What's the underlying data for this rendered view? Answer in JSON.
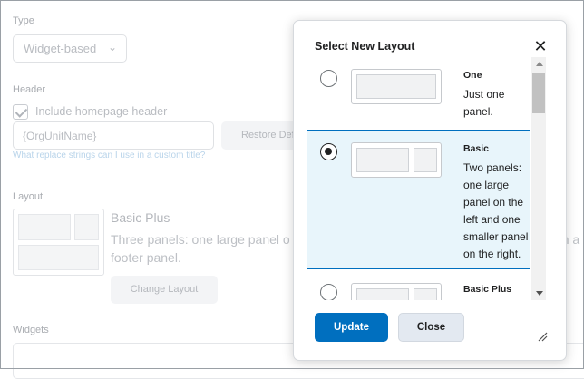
{
  "page": {
    "type_label": "Type",
    "type_select_value": "Widget-based",
    "header_label": "Header",
    "include_header_label": "Include homepage header",
    "title_input_value": "{OrgUnitName}",
    "restore_button_label": "Restore Default",
    "help_link": "What replace strings can I use in a custom title?",
    "layout_label": "Layout",
    "current_layout_name": "Basic Plus",
    "current_layout_desc_line1a": "Three panels: one large panel o",
    "current_layout_desc_line1b": "h a",
    "current_layout_desc_line2": "footer panel.",
    "change_layout_label": "Change Layout",
    "widgets_label": "Widgets"
  },
  "dialog": {
    "title": "Select New Layout",
    "close_icon": "close-icon",
    "options": [
      {
        "name": "One",
        "desc": "Just one panel.",
        "selected": false
      },
      {
        "name": "Basic",
        "desc": "Two panels: one large panel on the left and one smaller panel on the right.",
        "selected": true
      },
      {
        "name": "Basic Plus",
        "desc": "...",
        "selected": false
      }
    ],
    "update_label": "Update",
    "close_label": "Close"
  },
  "colors": {
    "accent": "#006fbf",
    "selected_bg": "#e8f5fb"
  }
}
